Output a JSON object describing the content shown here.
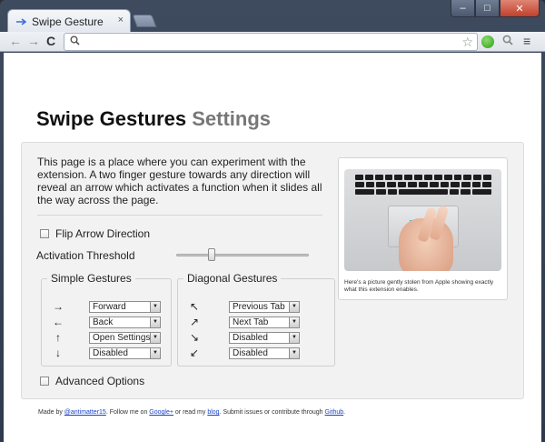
{
  "tab": {
    "title": "Swipe Gesture",
    "close": "×"
  },
  "window_controls": {
    "minimize": "–",
    "maximize": "□",
    "close": "✕"
  },
  "toolbar": {
    "back": "←",
    "forward": "→",
    "reload": "C",
    "search_icon": "🔍",
    "star": "☆",
    "menu": "≡"
  },
  "page": {
    "title_main": "Swipe Gestures",
    "title_sub": "Settings",
    "intro": "This page is a place where you can experiment with the extension. A two finger gesture towards any direction will reveal an arrow which activates a function when it slides all the way across the page.",
    "flip_label": "Flip Arrow Direction",
    "threshold_label": "Activation Threshold",
    "threshold_value": 0.25,
    "simple": {
      "legend": "Simple Gestures",
      "rows": [
        {
          "arrow": "→",
          "value": "Forward"
        },
        {
          "arrow": "←",
          "value": "Back"
        },
        {
          "arrow": "↑",
          "value": "Open Settings"
        },
        {
          "arrow": "↓",
          "value": "Disabled"
        }
      ]
    },
    "diagonal": {
      "legend": "Diagonal Gestures",
      "rows": [
        {
          "arrow": "↖",
          "value": "Previous Tab"
        },
        {
          "arrow": "↗",
          "value": "Next Tab"
        },
        {
          "arrow": "↘",
          "value": "Disabled"
        },
        {
          "arrow": "↙",
          "value": "Disabled"
        }
      ]
    },
    "advanced_label": "Advanced Options",
    "caption": "Here's a picture gently stolen from Apple showing exactly what this extension enables.",
    "footer": {
      "t1": "Made by ",
      "l1": "@antimatter15",
      "t2": ". Follow me on ",
      "l2": "Google+",
      "t3": " or read my ",
      "l3": "blog",
      "t4": ". Submit issues or contribute through ",
      "l4": "Github",
      "t5": "."
    }
  },
  "colors": {
    "accent_swipe": "#36b6e6",
    "link": "#1a44c6"
  }
}
